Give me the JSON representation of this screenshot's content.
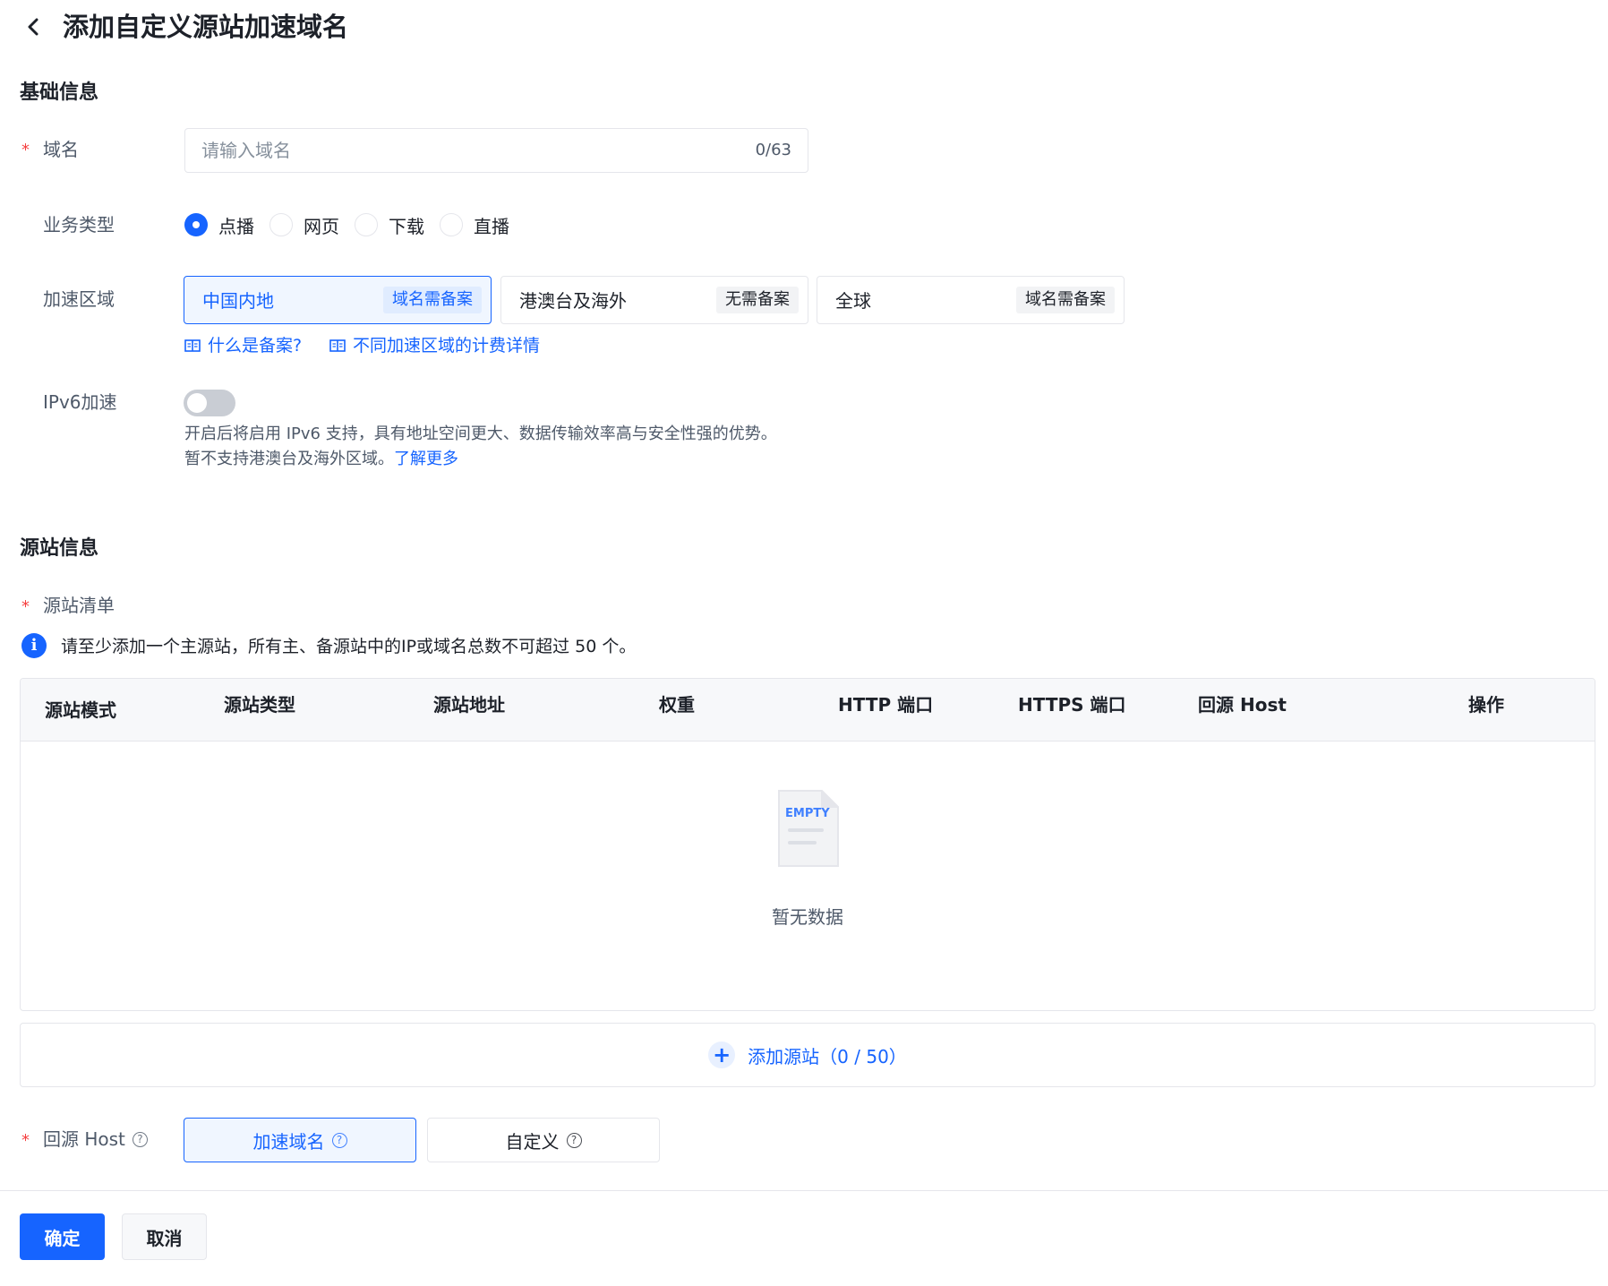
{
  "header": {
    "title": "添加自定义源站加速域名",
    "back_icon": "chevron-left-icon"
  },
  "basic": {
    "section_title": "基础信息",
    "domain": {
      "label": "域名",
      "required_mark": "*",
      "placeholder": "请输入域名",
      "value": "",
      "count": "0/63"
    },
    "business_type": {
      "label": "业务类型",
      "options": [
        {
          "label": "点播",
          "checked": true
        },
        {
          "label": "网页",
          "checked": false
        },
        {
          "label": "下载",
          "checked": false
        },
        {
          "label": "直播",
          "checked": false
        }
      ]
    },
    "region": {
      "label": "加速区域",
      "options": [
        {
          "name": "中国内地",
          "tag": "域名需备案",
          "selected": true
        },
        {
          "name": "港澳台及海外",
          "tag": "无需备案",
          "selected": false
        },
        {
          "name": "全球",
          "tag": "域名需备案",
          "selected": false
        }
      ],
      "links": [
        {
          "text": "什么是备案?",
          "icon": "book-icon"
        },
        {
          "text": "不同加速区域的计费详情",
          "icon": "book-icon"
        }
      ]
    },
    "ipv6": {
      "label": "IPv6加速",
      "enabled": false,
      "help_line1": "开启后将启用 IPv6 支持，具有地址空间更大、数据传输效率高与安全性强的优势。",
      "help_line2": "暂不支持港澳台及海外区域。",
      "learn_more": "了解更多"
    }
  },
  "origin": {
    "section_title": "源站信息",
    "list_label": "源站清单",
    "required_mark": "*",
    "info_icon": "i",
    "info_text": "请至少添加一个主源站，所有主、备源站中的IP或域名总数不可超过 50 个。",
    "table": {
      "columns": [
        "源站模式",
        "源站类型",
        "源站地址",
        "权重",
        "HTTP 端口",
        "HTTPS 端口",
        "回源 Host",
        "操作"
      ],
      "rows": [],
      "empty_badge": "EMPTY",
      "empty_text": "暂无数据"
    },
    "add_button": {
      "plus": "+",
      "label": "添加源站（0 / 50）"
    },
    "host": {
      "label": "回源 Host",
      "help_icon": "?",
      "options": [
        {
          "label": "加速域名",
          "selected": true
        },
        {
          "label": "自定义",
          "selected": false
        }
      ]
    }
  },
  "footer": {
    "confirm": "确定",
    "cancel": "取消"
  },
  "colors": {
    "primary": "#1664ff",
    "required": "#f53f3f",
    "border": "#e5e6eb"
  }
}
